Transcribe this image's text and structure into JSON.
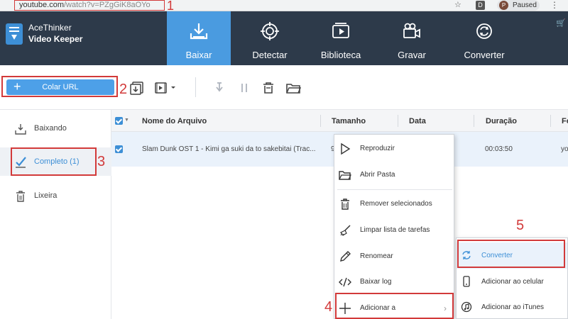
{
  "browser": {
    "url_host": "youtube.com",
    "url_path": "/watch?v=PZgGiK8aOYo",
    "extension_letter": "D",
    "profile_letter": "P",
    "status": "Paused"
  },
  "app": {
    "name_line1": "AceThinker",
    "name_line2": "Video Keeper",
    "nav": [
      {
        "label": "Baixar",
        "icon": "download-icon",
        "active": true
      },
      {
        "label": "Detectar",
        "icon": "target-icon"
      },
      {
        "label": "Biblioteca",
        "icon": "library-icon"
      },
      {
        "label": "Gravar",
        "icon": "camera-icon"
      },
      {
        "label": "Converter",
        "icon": "convert-icon"
      }
    ]
  },
  "toolbar": {
    "paste_url_label": "Colar URL"
  },
  "annotations": [
    "1",
    "2",
    "3",
    "4",
    "5"
  ],
  "sidebar": {
    "items": [
      {
        "label": "Baixando",
        "icon": "download-tray-icon"
      },
      {
        "label": "Completo (1)",
        "icon": "check-icon",
        "active": true
      },
      {
        "label": "Lixeira",
        "icon": "trash-icon"
      }
    ]
  },
  "table": {
    "headers": [
      "Nome do Arquivo",
      "Tamanho",
      "Data",
      "Duração",
      "Fo"
    ],
    "rows": [
      {
        "name": "Slam Dunk  OST 1 -  Kimi ga suki da to sakebitai (Trac...",
        "size": "9",
        "date": "",
        "duration": "00:03:50",
        "format": "yo"
      }
    ]
  },
  "context_menu": {
    "items": [
      {
        "label": "Reproduzir",
        "icon": "play-icon"
      },
      {
        "label": "Abrir Pasta",
        "icon": "folder-icon"
      },
      {
        "label": "Remover selecionados",
        "icon": "trash-icon"
      },
      {
        "label": "Limpar lista de tarefas",
        "icon": "broom-icon"
      },
      {
        "label": "Renomear",
        "icon": "pencil-icon"
      },
      {
        "label": "Baixar log",
        "icon": "code-icon"
      },
      {
        "label": "Adicionar a",
        "icon": "plus-icon"
      }
    ]
  },
  "submenu": {
    "items": [
      {
        "label": "Converter",
        "icon": "convert-icon"
      },
      {
        "label": "Adicionar ao celular",
        "icon": "phone-icon"
      },
      {
        "label": "Adicionar ao iTunes",
        "icon": "music-icon"
      }
    ]
  },
  "colors": {
    "header_bg": "#2d3a4a",
    "accent": "#4a9be0",
    "annotation_red": "#d23a3a"
  }
}
